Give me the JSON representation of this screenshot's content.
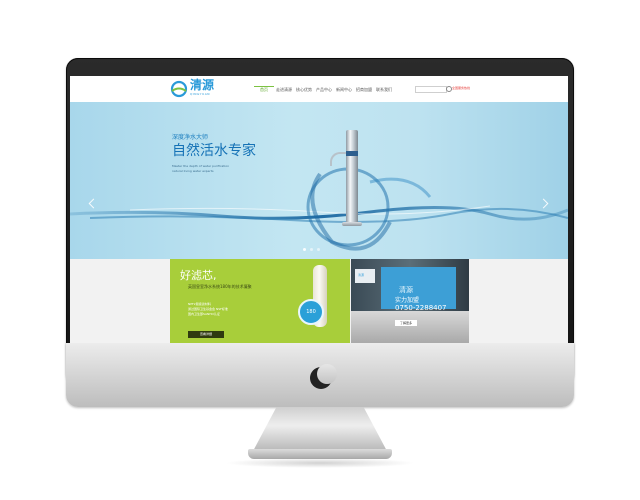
{
  "site": {
    "logo_text": "清源",
    "logo_sub": "QINGYUAN",
    "nav": [
      "首页",
      "走进清源",
      "核心优势",
      "产品中心",
      "新闻中心",
      "招商加盟",
      "联系我们"
    ],
    "active_nav_index": 0,
    "hotline": "全国服务热线"
  },
  "hero": {
    "kicker": "深度净水大师",
    "title": "自然活水专家",
    "desc_line1": "Master the depth of water purification",
    "desc_line2": "natural living water experts",
    "slides": 3,
    "active_slide": 0
  },
  "promo_left": {
    "title": "好滤芯,",
    "subtitle": "英国皇室净水系统180年的技术凝聚",
    "desc_line1": "NPF2膜级滤材料",
    "desc_line2": "通过国际卫生基金会 NSF标准",
    "desc_line3": "国内卫生部SANHO认证",
    "button": "查看详细",
    "badge": "180"
  },
  "promo_right": {
    "title": "实力加盟",
    "phone": "0750-2288407",
    "button": "了解更多",
    "wall_logo": "清源",
    "sign_logo": "清源"
  },
  "colors": {
    "brand_blue": "#2a9ad9",
    "brand_green": "#a8ce3a",
    "nav_active": "#5ea72a",
    "hotline_red": "#e53935"
  }
}
